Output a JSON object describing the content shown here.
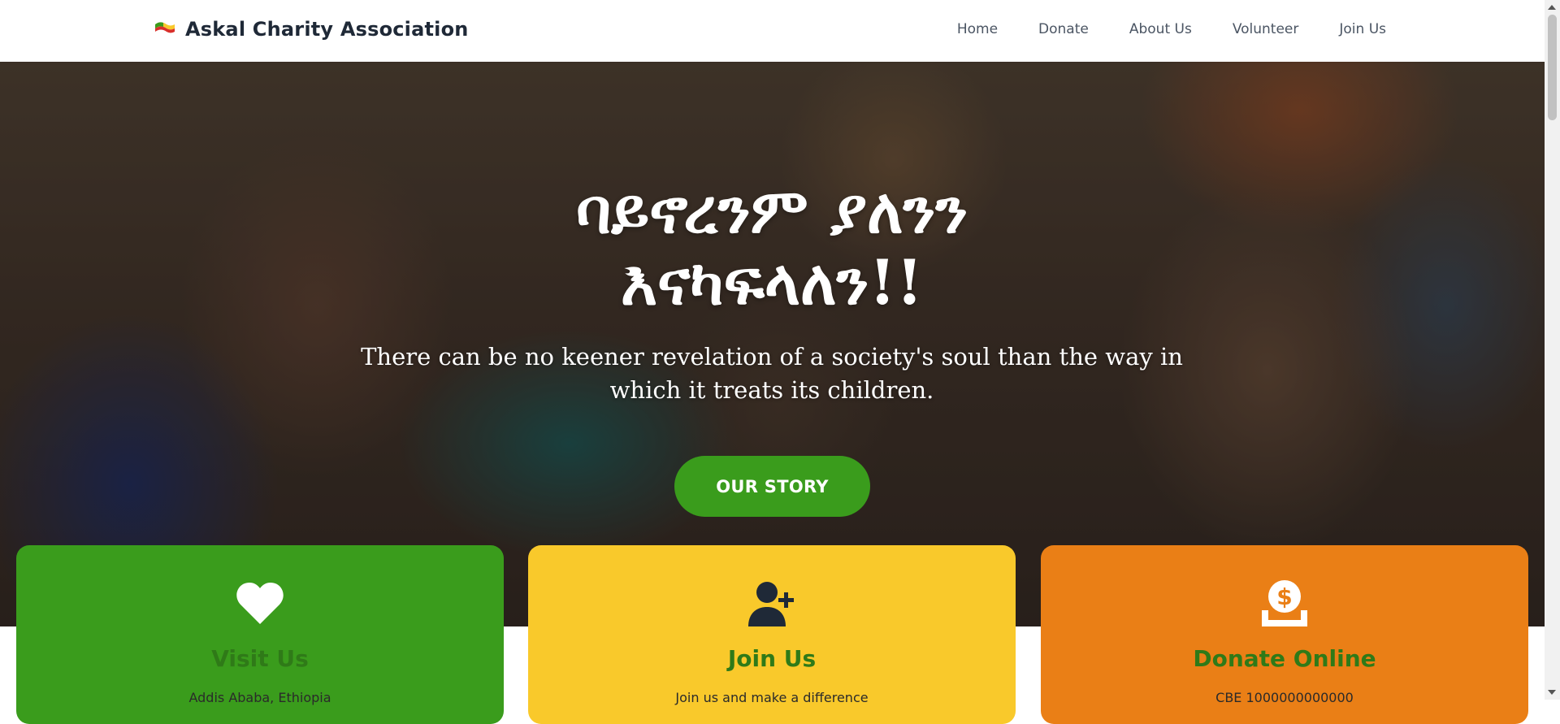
{
  "navbar": {
    "brand": "Askal Charity Association",
    "logo_icon": "flag-logo-icon",
    "links": [
      "Home",
      "Donate",
      "About Us",
      "Volunteer",
      "Join Us"
    ]
  },
  "hero": {
    "title_line1": "ባይኖረንም ያለንን",
    "title_line2": "እናካፍላለን!!",
    "quote": "There can be no keener revelation of a society's soul than the way in which it treats its children.",
    "button_label": "OUR STORY"
  },
  "cards": [
    {
      "title": "Visit Us",
      "icon": "heart-icon",
      "color": "#3a9c1c",
      "text": "Addis Ababa, Ethiopia"
    },
    {
      "title": "Join Us",
      "icon": "user-plus-icon",
      "color": "#f9c92b",
      "text": "Join us and make a difference"
    },
    {
      "title": "Donate Online",
      "icon": "donate-icon",
      "color": "#ea7f16",
      "text": "CBE 1000000000000"
    }
  ],
  "colors": {
    "primary_green": "#3a9c1c",
    "yellow": "#f9c92b",
    "orange": "#ea7f16",
    "title_green": "#2f7a18"
  }
}
